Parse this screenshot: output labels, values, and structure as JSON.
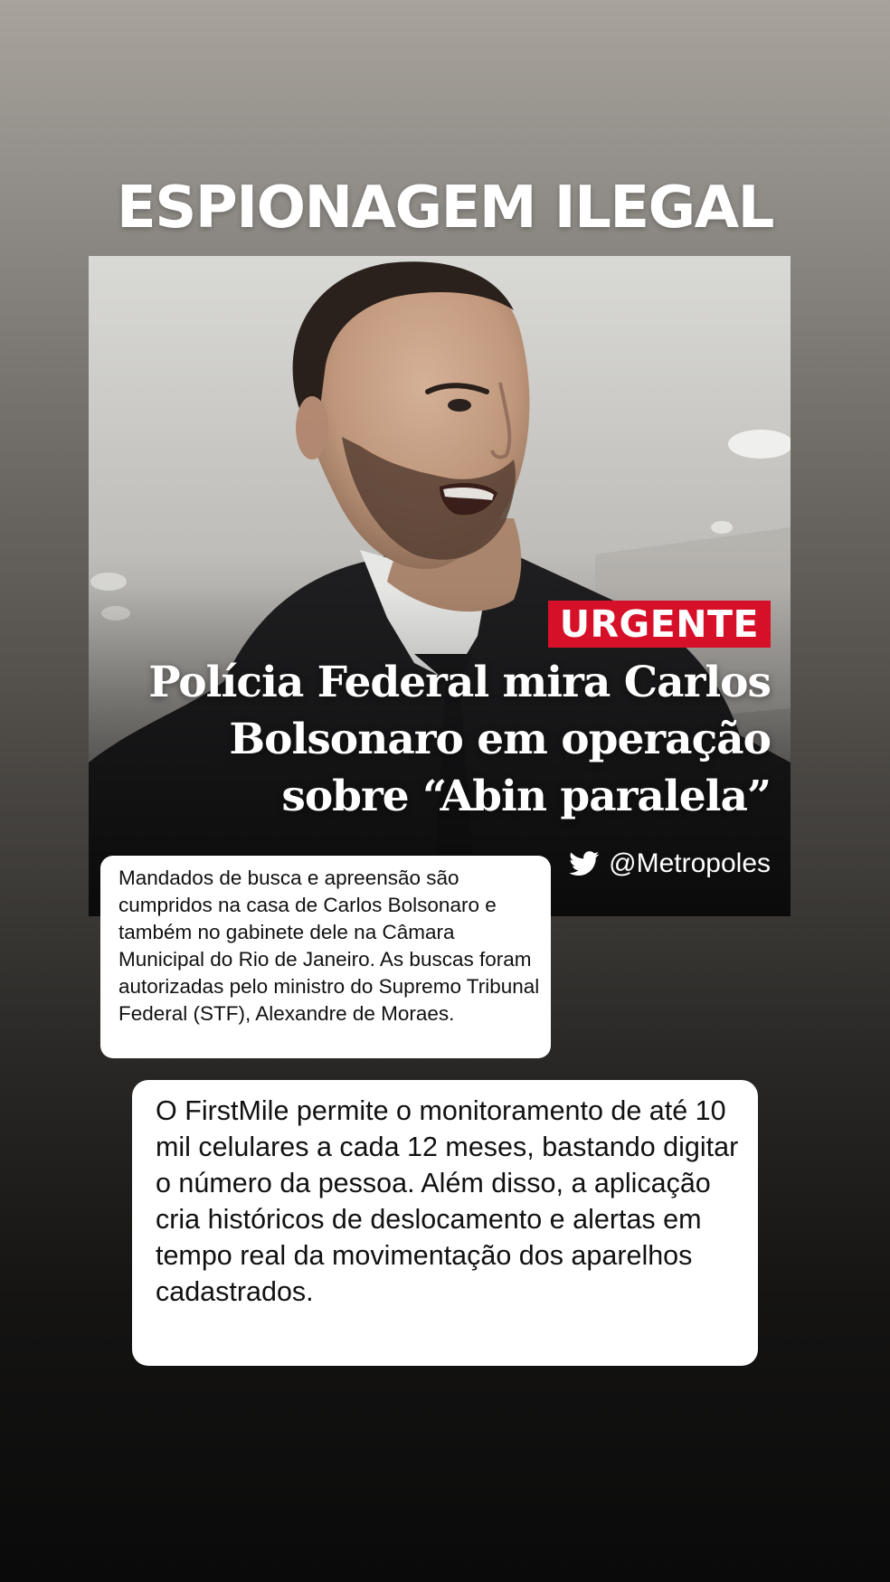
{
  "headline": "ESPIONAGEM ILEGAL",
  "news_card": {
    "badge": "URGENTE",
    "title": "Polícia Federal mira Carlos Bolsonaro em operação sobre “Abin paralela”",
    "source_handle": "@Metropoles",
    "source_icon": "twitter-bird-icon",
    "badge_color": "#d7102a"
  },
  "note_small": {
    "text": "Mandados de busca e apreensão são cumpridos na casa de Carlos Bolsonaro e também no gabinete dele na Câmara Municipal do Rio de Janeiro. As buscas foram autorizadas pelo ministro do Supremo Tribunal Federal (STF), Alexandre de Moraes."
  },
  "note_large": {
    "text": "O FirstMile permite o monitoramento de até 10 mil celulares a cada 12 meses, bastando digitar o número da pessoa. Além disso, a aplicação cria históricos de deslocamento e alertas em tempo real da movimentação dos aparelhos cadastrados."
  }
}
